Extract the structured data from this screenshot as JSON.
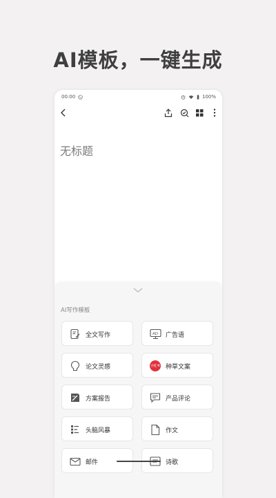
{
  "headline": "AI模板，一键生成",
  "status": {
    "time": "00:00",
    "battery": "100%"
  },
  "document": {
    "title": "无标题"
  },
  "panel": {
    "title": "AI写作模板",
    "templates": [
      {
        "label": "全文写作",
        "icon": "edit-doc-icon"
      },
      {
        "label": "广告语",
        "icon": "ad-icon"
      },
      {
        "label": "论文灵感",
        "icon": "bulb-icon"
      },
      {
        "label": "种草文案",
        "icon": "xiaohongshu-icon",
        "badge": "小红书",
        "badge_color": "#e0313b"
      },
      {
        "label": "方案报告",
        "icon": "report-icon"
      },
      {
        "label": "产品评论",
        "icon": "comment-icon"
      },
      {
        "label": "头脑风暴",
        "icon": "brainstorm-icon"
      },
      {
        "label": "作文",
        "icon": "file-icon"
      },
      {
        "label": "邮件",
        "icon": "mail-icon"
      },
      {
        "label": "诗歌",
        "icon": "poem-icon"
      }
    ]
  }
}
